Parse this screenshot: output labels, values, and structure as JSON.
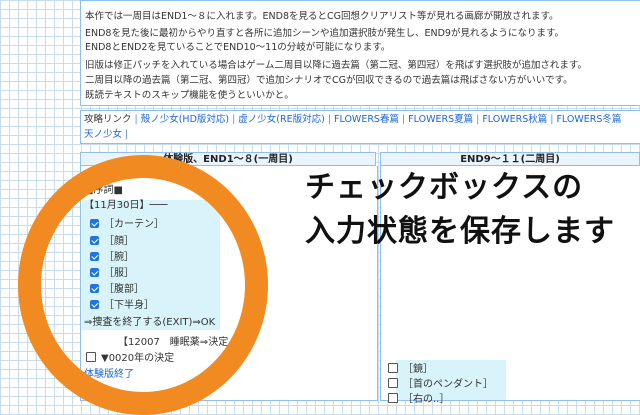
{
  "notes": [
    "本作では一周目はEND1～８に入れます。END8を見るとCG回想クリアリスト等が見れる画廊が開放されます。",
    "END8を見た後に最初からやり直すと各所に追加シーンや追加選択肢が発生し、END9が見れるようになります。",
    "END8とEND2を見ていることでEND10～11の分岐が可能になります。",
    "旧版は修正パッチを入れている場合はゲーム二周目以降に過去篇（第二冠、第四冠）を飛ばす選択肢が追加されます。",
    "二周目以降の過去篇（第二冠、第四冠）で追加シナリオでCGが回収できるので過去篇は飛ばさない方がいいです。",
    "既読テキストのスキップ機能を使うといいかと。"
  ],
  "nav": {
    "label": "攻略リンク",
    "links": [
      "殻ノ少女(HD版対応)",
      "虚ノ少女(RE版対応)",
      "FLOWERS春篇",
      "FLOWERS夏篇",
      "FLOWERS秋篇",
      "FLOWERS冬篇"
    ],
    "last_link": "天ノ少女"
  },
  "columns": {
    "left_heading": "体験版、END1～８(一周目)",
    "right_heading": "END9～１１(二周目)"
  },
  "left": {
    "trial_label": "体験版",
    "section": "■序詞■",
    "date": "【11月30日】───",
    "checkboxes": [
      "［カーテン］",
      "［顔］",
      "［腕］",
      "［服］",
      "［腹部］",
      "［下半身］"
    ],
    "exit_line": "⇒捜査を終了する(EXIT)⇒OK",
    "partial_line": "【12007　睡眠薬⇒決定",
    "partial_line2": "▼0020年の決定",
    "trial_end": "体験版終了"
  },
  "right": {
    "items": [
      "［鏡］",
      "［首のペンダント］",
      "［右の..］"
    ]
  },
  "overlay": {
    "line1": "チェックボックスの",
    "line2": "入力状態を保存します"
  },
  "colors": {
    "accent": "#f28a22",
    "link": "#1a66d9",
    "checkbox": "#1f74e0",
    "highlight": "#d8f3f9",
    "border": "#8fc1e8"
  }
}
